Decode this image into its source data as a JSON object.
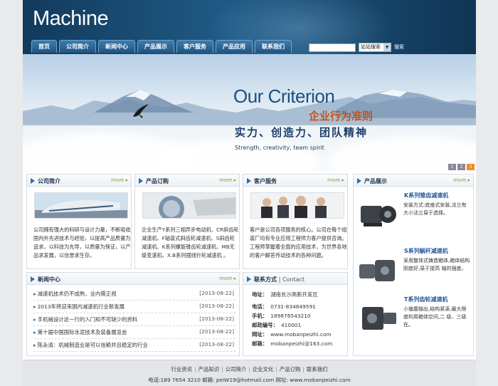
{
  "header": {
    "logo": "Machine"
  },
  "nav": {
    "items": [
      "首页",
      "公司简介",
      "新闻中心",
      "产品展示",
      "客户服务",
      "产品应用",
      "联系我们"
    ]
  },
  "search": {
    "value": "",
    "select_value": "站站搜索",
    "button_label": "搜索"
  },
  "banner": {
    "title": "Our Criterion",
    "cn_line1": "企业行为准则",
    "cn_line2": "实力、创造力、团队精神",
    "en_line": "Strength, creativity, team spirit",
    "dots": [
      "1",
      "2",
      "3"
    ]
  },
  "about": {
    "title": "公司简介",
    "more": "more",
    "text": "公司拥有强大的科研与设计力量，不断吸收国内外先进技术与经验，以提高产品质量为追求，以科技为先导，以质量为保证，以产品求发展，以信誉求生存。"
  },
  "order": {
    "title": "产品订购",
    "more": "more",
    "text": "企业生产Y系列三相异步电动机、CR斜齿轮减速机、F轴装式斜齿轮减速机、S斜齿轮减速机、K系列螺旋锥齿轮减速机、MB无级变速机、X.B系列摆线针轮减速机 。"
  },
  "service": {
    "title": "客户服务",
    "more": "more",
    "text": "客户是公司各项服务的核心。公司在每个组装厂均有专业应用工程师为客户提供咨询。工程师掌握着全面的应用技术，为世界各地的客户解答传动技术的各种问题。"
  },
  "products": {
    "title": "产品展示",
    "more": "more",
    "items": [
      {
        "title": "K系列锥齿减速机",
        "desc": "安装方式:底座式安装,法兰有大小法兰易于选择。"
      },
      {
        "title": "S系列蜗杆减速机",
        "desc": "采用整体式铸造箱体,箱体结构刚度好,易于提高 轴的强度。"
      },
      {
        "title": "T系列齿轮减速机",
        "desc": "小偏置输出,结构紧凑,最大限度利用箱体空间,二 级、三级在。"
      }
    ]
  },
  "news": {
    "title": "新闻中心",
    "more": "more",
    "items": [
      {
        "title": "减速机技术仍不成熟，业内需正视",
        "date": "[2013-08-22]"
      },
      {
        "title": "2013年将迎来国内减速机行业新发展",
        "date": "[2013-08-22]"
      },
      {
        "title": "手机械设计这一行的入门和不可缺少的资料",
        "date": "[2013-08-22]"
      },
      {
        "title": "第十届中国国际水泥技术及装备展览会",
        "date": "[2013-08-22]"
      },
      {
        "title": "陈永清：机械制造业是可以信赖并且稳定的行业",
        "date": "[2013-08-22]"
      }
    ]
  },
  "contact": {
    "title": "联系方式",
    "subtitle": "| Contact",
    "rows": [
      {
        "label": "地址：",
        "value": "湖南长沙高新开发区"
      },
      {
        "label": "电话：",
        "value": "0731-834849591"
      },
      {
        "label": "手机：",
        "value": "189876543210"
      },
      {
        "label": "邮政编号：",
        "value": "410001"
      },
      {
        "label": "网址：",
        "value": "www.mobanpeizhi.com"
      },
      {
        "label": "邮箱：",
        "value": "mobanpeizhi@163.com"
      }
    ]
  },
  "footer": {
    "links": [
      "行业资讯",
      "产品知识",
      "公司简介",
      "企业文化",
      "产品订购",
      "联系我们"
    ],
    "contact": "电话:189 7654 3210 邮箱: peiW19@hotmail.com 网址: www.mobanpeizhi.com"
  },
  "colors": {
    "header": "#1f5a85",
    "accent": "#2a6fb0",
    "orange": "#c0541d",
    "more": "#7aa43b"
  }
}
